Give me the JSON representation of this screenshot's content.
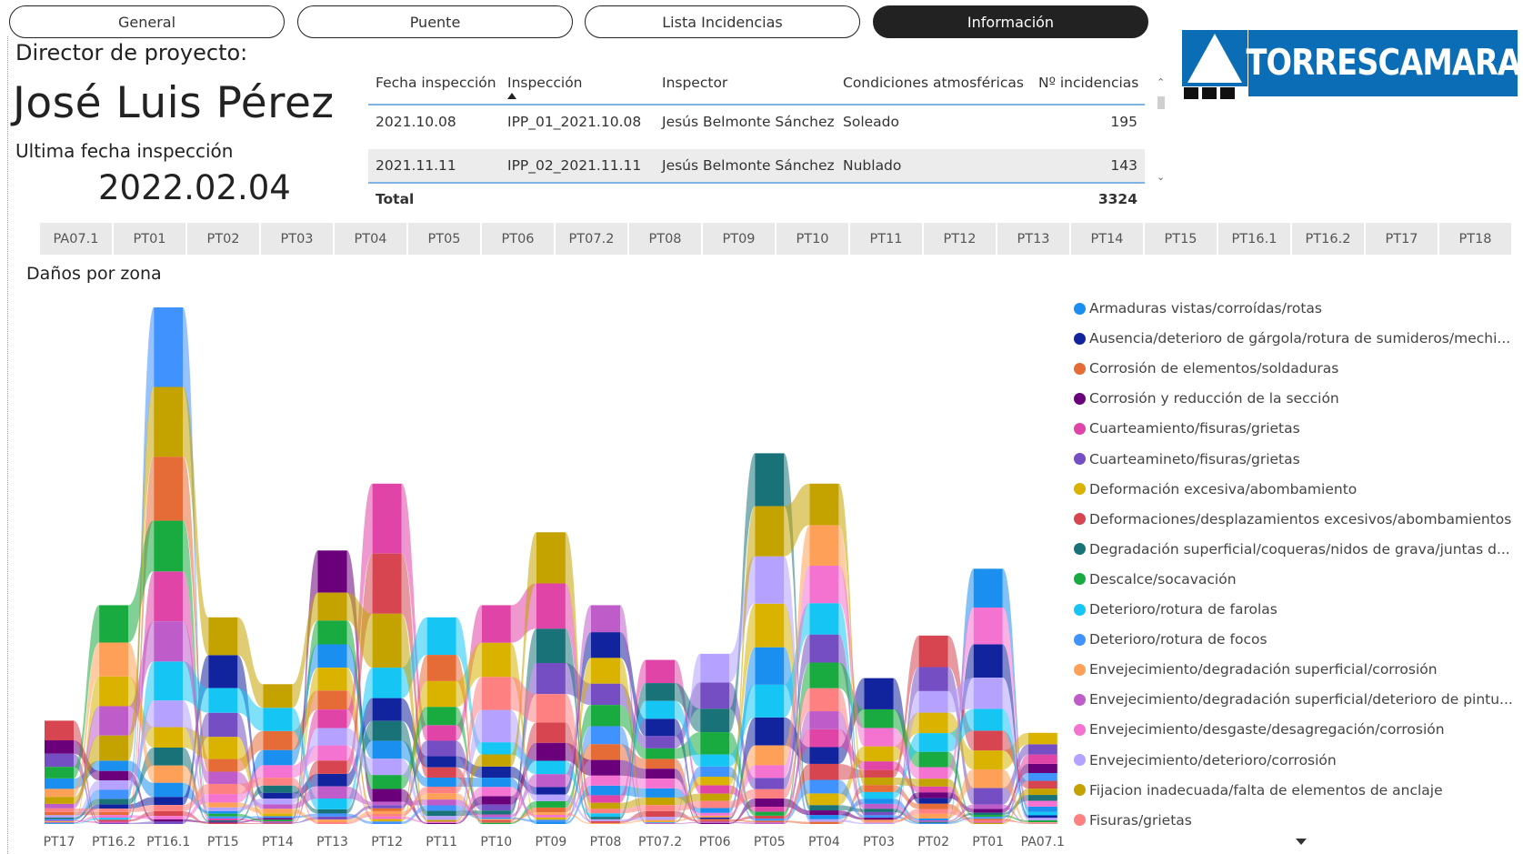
{
  "nav": {
    "tabs": [
      {
        "label": "General",
        "active": false
      },
      {
        "label": "Puente",
        "active": false
      },
      {
        "label": "Lista Incidencias",
        "active": false
      },
      {
        "label": "Información",
        "active": true
      }
    ]
  },
  "summary": {
    "director_label": "Director de proyecto:",
    "director_name": "José Luis Pérez",
    "last_inspection_label": "Ultima fecha inspección",
    "last_inspection_date": "2022.02.04"
  },
  "inspections_table": {
    "columns": [
      "Fecha inspección",
      "Inspección",
      "Inspector",
      "Condiciones atmosféricas",
      "Nº incidencias"
    ],
    "sorted_column": "Inspección",
    "rows": [
      {
        "fecha": "2021.10.08",
        "inspeccion": "IPP_01_2021.10.08",
        "inspector": "Jesús Belmonte Sánchez",
        "condiciones": "Soleado",
        "incidencias": "195"
      },
      {
        "fecha": "2021.11.11",
        "inspeccion": "IPP_02_2021.11.11",
        "inspector": "Jesús Belmonte Sánchez",
        "condiciones": "Nublado",
        "incidencias": "143"
      }
    ],
    "total_label": "Total",
    "total_value": "3324"
  },
  "logo": {
    "text": "TORRESCAMARA",
    "color": "#0a6db5"
  },
  "zone_slicer": {
    "items": [
      "PA07.1",
      "PT01",
      "PT02",
      "PT03",
      "PT04",
      "PT05",
      "PT06",
      "PT07.2",
      "PT08",
      "PT09",
      "PT10",
      "PT11",
      "PT12",
      "PT13",
      "PT14",
      "PT15",
      "PT16.1",
      "PT16.2",
      "PT17",
      "PT18"
    ]
  },
  "chart_title": "Daños por zona",
  "chart_data": {
    "type": "area",
    "subtype": "ribbon",
    "title": "Daños por zona",
    "categories": [
      "PT17",
      "PT16.2",
      "PT16.1",
      "PT15",
      "PT14",
      "PT13",
      "PT12",
      "PT11",
      "PT10",
      "PT09",
      "PT08",
      "PT07.2",
      "PT06",
      "PT05",
      "PT04",
      "PT03",
      "PT02",
      "PT01",
      "PA07.1"
    ],
    "totals": [
      17,
      36,
      85,
      34,
      23,
      45,
      56,
      34,
      36,
      48,
      36,
      27,
      28,
      61,
      56,
      24,
      31,
      42,
      15
    ],
    "legend_position": "right",
    "series": [
      {
        "name": "Armaduras vistas/corroídas/rotas",
        "color": "#1b8ff0"
      },
      {
        "name": "Ausencia/deterioro de gárgola/rotura de sumideros/mechi...",
        "color": "#12239e"
      },
      {
        "name": "Corrosión de elementos/soldaduras",
        "color": "#e66c37"
      },
      {
        "name": "Corrosión y reducción de la sección",
        "color": "#6b007b"
      },
      {
        "name": "Cuarteamiento/fisuras/grietas",
        "color": "#e044a7"
      },
      {
        "name": "Cuarteamineto/fisuras/grietas",
        "color": "#744ec2"
      },
      {
        "name": "Deformación excesiva/abombamiento",
        "color": "#d9b300"
      },
      {
        "name": "Deformaciones/desplazamientos excesivos/abombamientos",
        "color": "#d64550"
      },
      {
        "name": "Degradación superficial/coqueras/nidos de grava/juntas d...",
        "color": "#197278"
      },
      {
        "name": "Descalce/socavación",
        "color": "#1aab40"
      },
      {
        "name": "Deterioro/rotura de farolas",
        "color": "#15c6f4"
      },
      {
        "name": "Deterioro/rotura de focos",
        "color": "#4092ff"
      },
      {
        "name": "Envejecimiento/degradación superficial/corrosión",
        "color": "#ffa058"
      },
      {
        "name": "Envejecimiento/degradación superficial/deterioro de pintu...",
        "color": "#be5dc9"
      },
      {
        "name": "Envejecimiento/desgaste/desagregación/corrosión",
        "color": "#f472d0"
      },
      {
        "name": "Envejecimiento/deterioro/corrosión",
        "color": "#b5a1ff"
      },
      {
        "name": "Fijacion inadecuada/falta de elementos de anclaje",
        "color": "#c4a200"
      },
      {
        "name": "Fisuras/grietas",
        "color": "#ff8080"
      }
    ]
  }
}
